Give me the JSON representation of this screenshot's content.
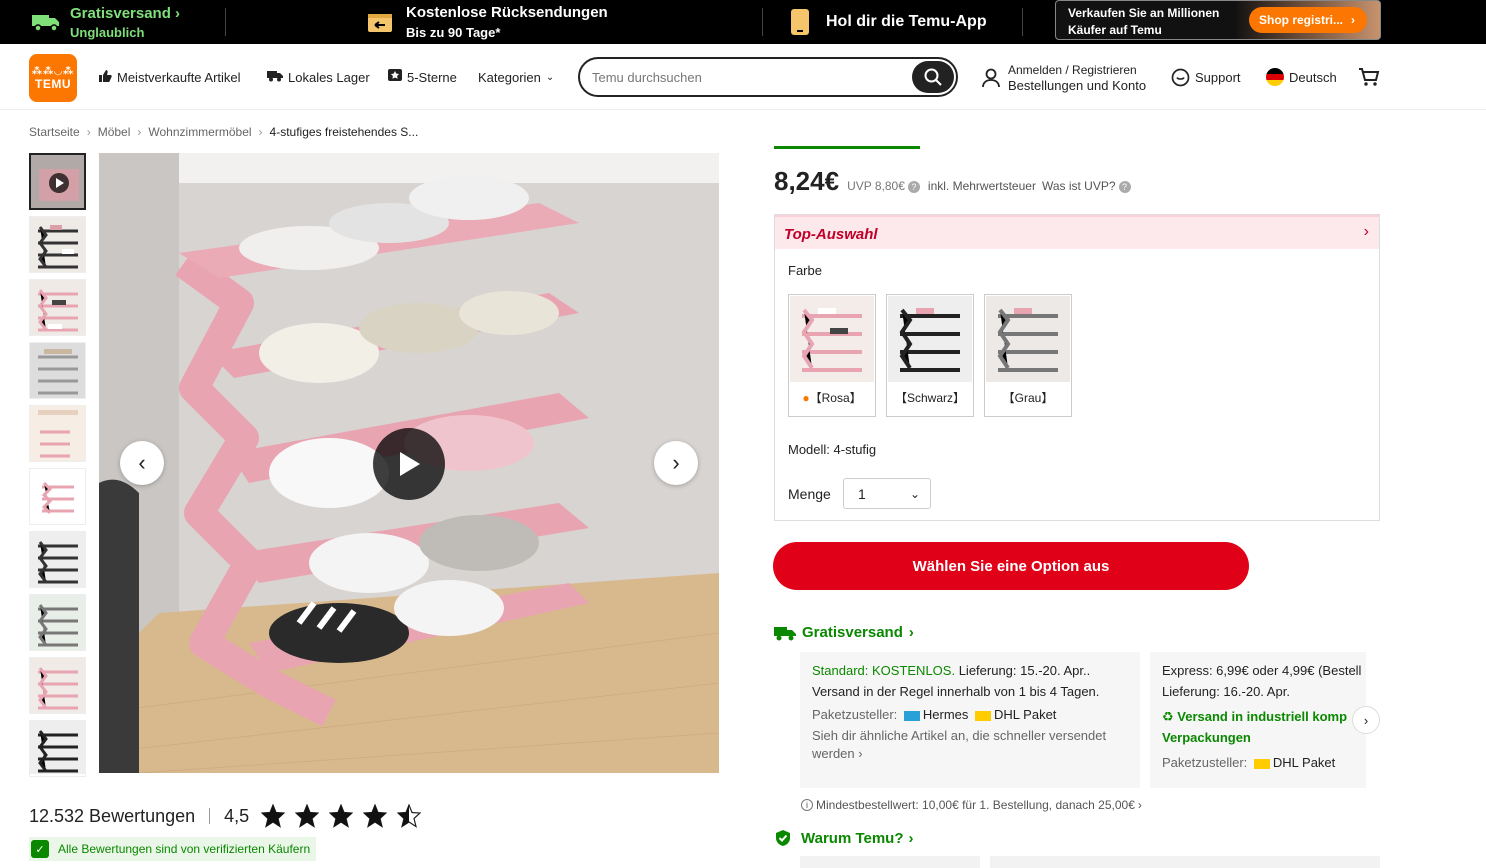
{
  "promo": {
    "shipping_title": "Gratisversand",
    "shipping_sub": "Unglaublich",
    "returns_title": "Kostenlose Rücksendungen",
    "returns_sub": "Bis zu 90 Tage*",
    "app_label": "Hol dir die Temu-App",
    "seller_line1": "Verkaufen Sie an Millionen",
    "seller_line2": "Käufer auf Temu",
    "seller_button": "Shop registri..."
  },
  "header": {
    "logo_top": "⁂⁂◡⁂",
    "logo_bottom": "TEMU",
    "nav": [
      "Meistverkaufte Artikel",
      "Lokales Lager",
      "5-Sterne",
      "Kategorien"
    ],
    "search_placeholder": "Temu durchsuchen",
    "account_line1": "Anmelden / Registrieren",
    "account_line2": "Bestellungen und Konto",
    "support": "Support",
    "language": "Deutsch"
  },
  "breadcrumb": [
    "Startseite",
    "Möbel",
    "Wohnzimmermöbel",
    "4-stufiges freistehendes S..."
  ],
  "product": {
    "price": "8,24€",
    "uvp": "UVP 8,80€",
    "inkl": "inkl. Mehrwertsteuer",
    "was_uvp": "Was ist UVP?",
    "top_auswahl": "Top-Auswahl",
    "farbe_label": "Farbe",
    "colors": [
      "【Rosa】",
      "【Schwarz】",
      "【Grau】"
    ],
    "modell": "Modell: 4-stufig",
    "menge_label": "Menge",
    "menge_value": "1",
    "cta": "Wählen Sie eine Option aus"
  },
  "shipping": {
    "title": "Gratisversand",
    "standard_label": "Standard: KOSTENLOS.",
    "standard_delivery": "Lieferung: 15.-20. Apr..",
    "standard_note": "Versand in der Regel innerhalb von 1 bis 4 Tagen.",
    "carriers_label": "Paketzusteller:",
    "carrier_hermes": "Hermes",
    "carrier_dhl": "DHL Paket",
    "faster_note": "Sieh dir ähnliche Artikel an, die schneller versendet werden",
    "express_label": "Express: 6,99€ oder 4,99€ (Bestell",
    "express_delivery": "Lieferung: 16.-20. Apr.",
    "eco_note": "Versand in industriell komp Verpackungen",
    "min_order": "Mindestbestellwert: 10,00€ für 1. Bestellung, danach 25,00€",
    "warum": "Warum Temu?"
  },
  "reviews": {
    "count": "12.532 Bewertungen",
    "score": "4,5",
    "rating_value": 4.5,
    "rating_max": 5,
    "verified": "Alle Bewertungen sind von verifizierten Käufern"
  },
  "colors": {
    "brand_orange": "#fb7701",
    "cta_red": "#e00018",
    "green": "#0a8800",
    "shelf_pink": "#e8a4b0"
  }
}
